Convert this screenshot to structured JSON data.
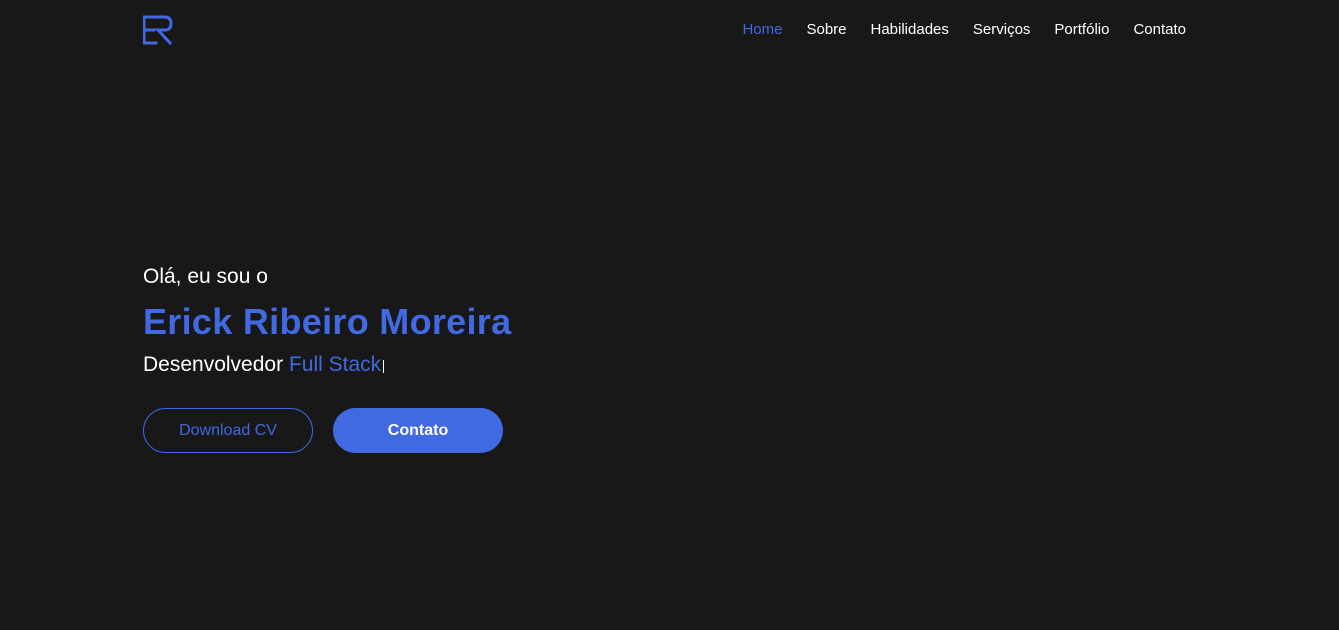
{
  "colors": {
    "background": "#181818",
    "accent": "#4169e1",
    "text": "#ffffff"
  },
  "header": {
    "logo_icon": "er-monogram-logo",
    "nav": [
      {
        "label": "Home",
        "active": true
      },
      {
        "label": "Sobre"
      },
      {
        "label": "Habilidades"
      },
      {
        "label": "Serviços"
      },
      {
        "label": "Portfólio"
      },
      {
        "label": "Contato"
      }
    ]
  },
  "hero": {
    "greeting": "Olá, eu sou o",
    "name": "Erick Ribeiro Moreira",
    "role_prefix": "Desenvolvedor",
    "role_highlight": "Full Stack",
    "buttons": {
      "download": "Download CV",
      "contact": "Contato"
    }
  }
}
